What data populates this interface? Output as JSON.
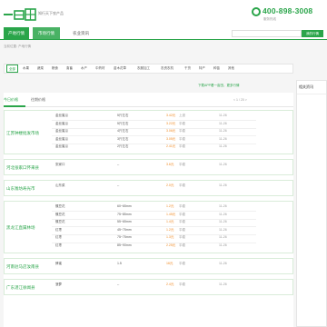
{
  "header": {
    "logo_text": "一亩田",
    "slogan": "知行天下农产品",
    "phone": "400-898-3008",
    "phone_sub": "服务热线",
    "brand_color": "#2aa54a"
  },
  "nav": {
    "tabs": [
      "产地行情",
      "市场行情",
      "农业资讯"
    ],
    "search_placeholder": "",
    "search_button": "我的行情"
  },
  "breadcrumb": "当前位置: 产地行情",
  "filters": [
    "全部",
    "水果",
    "蔬菜",
    "粮食",
    "禽畜",
    "水产",
    "中药材",
    "苗木花草",
    "农副加工",
    "农资农机",
    "干货",
    "特产",
    "种苗",
    "其他"
  ],
  "active_filter": "全部",
  "tabs": {
    "today": "今日价格",
    "history": "往期价格"
  },
  "pager": "< 1 / 20 >",
  "update_note": "下载APP看一亩田，更多行情",
  "sidebar": {
    "title": "相关资讯"
  },
  "groups": [
    {
      "market": "江苏钟楼批发市场",
      "rows": [
        {
          "name": "金丝蜜瓜",
          "spec": "5斤左右",
          "price": "3.42元",
          "trend": "上涨",
          "date": "11-26"
        },
        {
          "name": "金丝蜜瓜",
          "spec": "5斤左右",
          "price": "3.22元",
          "trend": "平稳",
          "date": "11-26"
        },
        {
          "name": "金丝蜜瓜",
          "spec": "4斤左右",
          "price": "3.06元",
          "trend": "平稳",
          "date": "11-26"
        },
        {
          "name": "金丝蜜瓜",
          "spec": "3斤左右",
          "price": "3.05元",
          "trend": "平稳",
          "date": "11-26"
        },
        {
          "name": "金丝蜜瓜",
          "spec": "2斤左右",
          "price": "2.41元",
          "trend": "平稳",
          "date": "11-26"
        }
      ]
    },
    {
      "market": "河北张家口怀来县",
      "rows": [
        {
          "name": "张家口",
          "spec": "--",
          "price": "3.6元",
          "trend": "平稳",
          "date": "11-26"
        }
      ]
    },
    {
      "market": "山东潍坊寿光市",
      "rows": [
        {
          "name": "山东菜",
          "spec": "--",
          "price": "2.0元",
          "trend": "平稳",
          "date": "11-26"
        }
      ]
    },
    {
      "market": "黑龙江直属林场",
      "rows": [
        {
          "name": "蝶豆花",
          "spec": "60~65mm",
          "price": "1.2元",
          "trend": "平稳",
          "date": "11-26"
        },
        {
          "name": "蝶豆花",
          "spec": "75~85mm",
          "price": "1.45元",
          "trend": "平稳",
          "date": "11-26"
        },
        {
          "name": "蝶豆花",
          "spec": "55~65mm",
          "price": "1.4元",
          "trend": "平稳",
          "date": "11-26"
        },
        {
          "name": "红枣",
          "spec": "45~75mm",
          "price": "1.2元",
          "trend": "平稳",
          "date": "11-26"
        },
        {
          "name": "红枣",
          "spec": "75~75mm",
          "price": "1.3元",
          "trend": "平稳",
          "date": "11-26"
        },
        {
          "name": "红枣",
          "spec": "85~90mm",
          "price": "2.25元",
          "trend": "平稳",
          "date": "11-26"
        }
      ]
    },
    {
      "market": "河南驻马店汝南县",
      "rows": [
        {
          "name": "蜂蜜",
          "spec": "1.5",
          "price": "16元",
          "trend": "平稳",
          "date": "11-26"
        }
      ]
    },
    {
      "market": "广东湛江徐闻县",
      "rows": [
        {
          "name": "菠萝",
          "spec": "--",
          "price": "2.4元",
          "trend": "平稳",
          "date": "11-26"
        }
      ]
    }
  ]
}
